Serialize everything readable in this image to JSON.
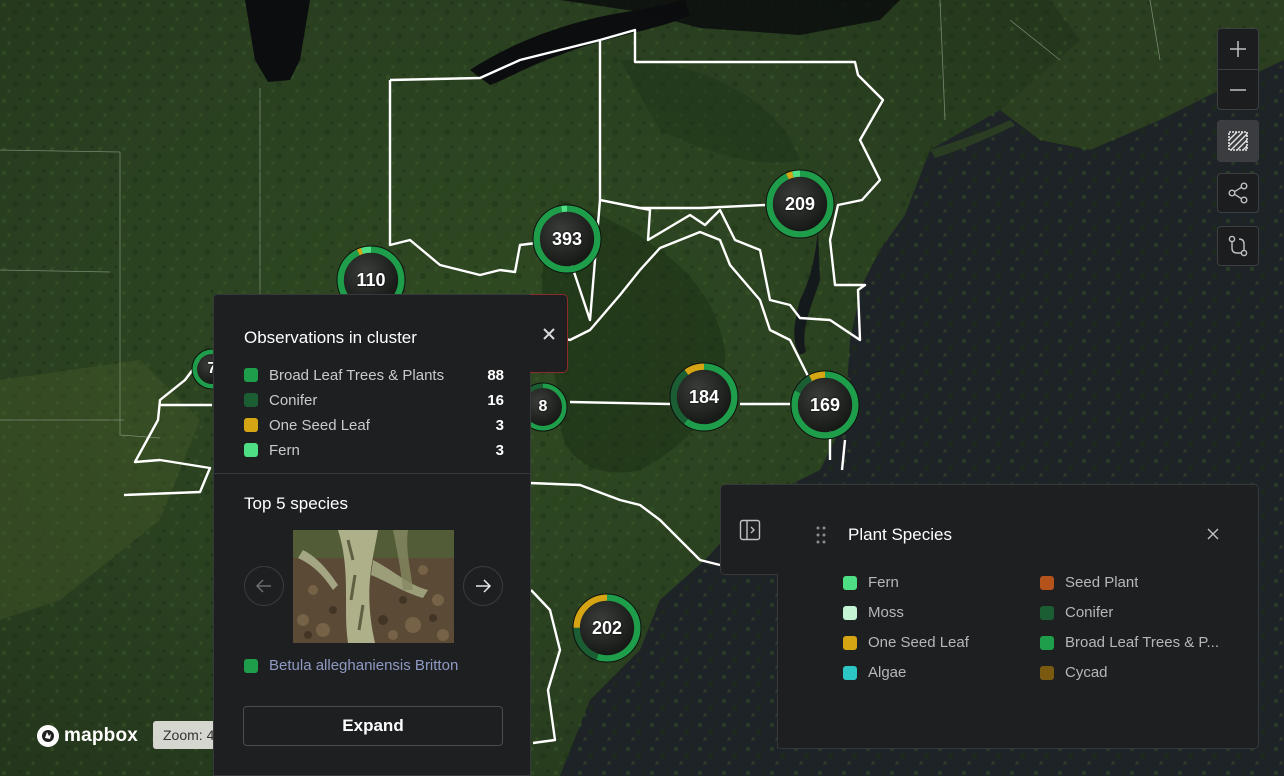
{
  "colors": {
    "broad_leaf": "#1e9e4a",
    "conifer": "#1b5e33",
    "one_seed_leaf": "#d6a514",
    "fern": "#4ede84",
    "moss": "#c4f4d3",
    "algae": "#2cc7c4",
    "seed_plant": "#b3521b",
    "cycad": "#7a5a10",
    "ocean": "#1d2326"
  },
  "map": {
    "clusters": [
      {
        "count": "393",
        "segments": [
          0.97,
          0.0,
          0.0,
          0.03
        ]
      },
      {
        "count": "110",
        "segments": [
          0.93,
          0.0,
          0.02,
          0.05
        ]
      },
      {
        "count": "209",
        "segments": [
          0.93,
          0.0,
          0.03,
          0.04
        ]
      },
      {
        "count": "184",
        "segments": [
          0.6,
          0.3,
          0.1,
          0.0
        ]
      },
      {
        "count": "169",
        "segments": [
          0.82,
          0.1,
          0.08,
          0.0
        ]
      },
      {
        "count": "202",
        "segments": [
          0.55,
          0.2,
          0.25,
          0.0
        ]
      },
      {
        "count": "8",
        "segments": [
          0.6,
          0.4,
          0.0,
          0.0
        ]
      },
      {
        "count": "7",
        "segments": [
          1.0,
          0.0,
          0.0,
          0.0
        ]
      }
    ],
    "controls": {
      "zoom_in": "plus-icon",
      "zoom_out": "minus-icon",
      "draw_area": "hatched-square-icon",
      "share": "share-icon",
      "route": "route-icon"
    },
    "attribution": "mapbox",
    "zoom_label": "Zoom: 4"
  },
  "popup": {
    "title": "Observations in cluster",
    "observations": [
      {
        "label": "Broad Leaf Trees & Plants",
        "count": "88",
        "color": "#1e9e4a"
      },
      {
        "label": "Conifer",
        "count": "16",
        "color": "#1b5e33"
      },
      {
        "label": "One Seed Leaf",
        "count": "3",
        "color": "#d6a514"
      },
      {
        "label": "Fern",
        "count": "3",
        "color": "#4ede84"
      }
    ],
    "top_species_title": "Top 5 species",
    "species_name": "Betula alleghaniensis Britton",
    "expand_label": "Expand"
  },
  "legend": {
    "title": "Plant Species",
    "items": [
      {
        "label": "Fern",
        "color": "#4ede84"
      },
      {
        "label": "Seed Plant",
        "color": "#b3521b"
      },
      {
        "label": "Moss",
        "color": "#c4f4d3"
      },
      {
        "label": "Conifer",
        "color": "#1b5e33"
      },
      {
        "label": "One Seed Leaf",
        "color": "#d6a514"
      },
      {
        "label": "Broad Leaf Trees & P...",
        "color": "#1e9e4a"
      },
      {
        "label": "Algae",
        "color": "#2cc7c4"
      },
      {
        "label": "Cycad",
        "color": "#7a5a10"
      }
    ]
  }
}
